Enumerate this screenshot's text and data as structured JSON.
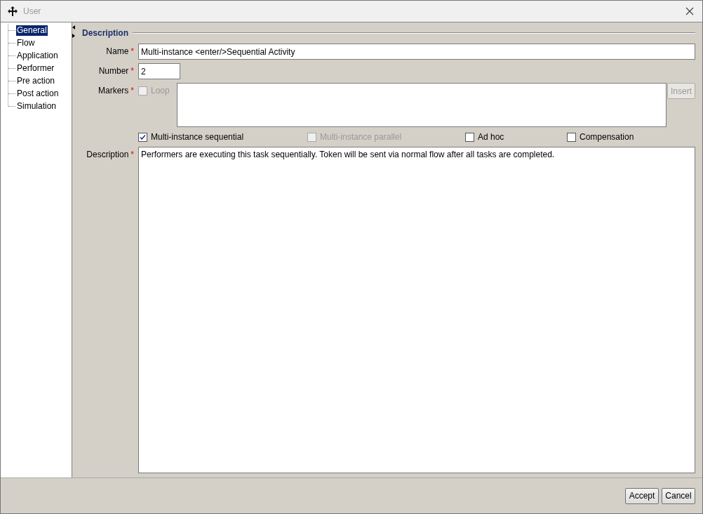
{
  "window": {
    "title": "User"
  },
  "tree": {
    "items": [
      {
        "label": "General",
        "selected": true
      },
      {
        "label": "Flow",
        "selected": false
      },
      {
        "label": "Application",
        "selected": false
      },
      {
        "label": "Performer",
        "selected": false
      },
      {
        "label": "Pre action",
        "selected": false
      },
      {
        "label": "Post action",
        "selected": false
      },
      {
        "label": "Simulation",
        "selected": false
      }
    ]
  },
  "section": {
    "title": "Description"
  },
  "name_field": {
    "label": "Name",
    "mark": "*",
    "value": "Multi-instance <enter/>Sequential Activity"
  },
  "number_field": {
    "label": "Number",
    "mark": "*",
    "value": "2"
  },
  "markers": {
    "label": "Markers",
    "mark": "*",
    "loop": {
      "label": "Loop",
      "checked": false,
      "disabled": true
    },
    "insert_button": {
      "label": "Insert",
      "disabled": true
    }
  },
  "flags": [
    {
      "label": "Multi-instance sequential",
      "checked": true,
      "disabled": false
    },
    {
      "label": "Multi-instance parallel",
      "checked": false,
      "disabled": true
    },
    {
      "label": "Ad hoc",
      "checked": false,
      "disabled": false
    },
    {
      "label": "Compensation",
      "checked": false,
      "disabled": false
    }
  ],
  "description_field": {
    "label": "Description",
    "mark": "*",
    "value": "Performers are executing this task sequentially. Token will be sent via normal flow after all tasks are completed."
  },
  "buttons": [
    {
      "label": "Accept"
    },
    {
      "label": "Cancel"
    }
  ]
}
